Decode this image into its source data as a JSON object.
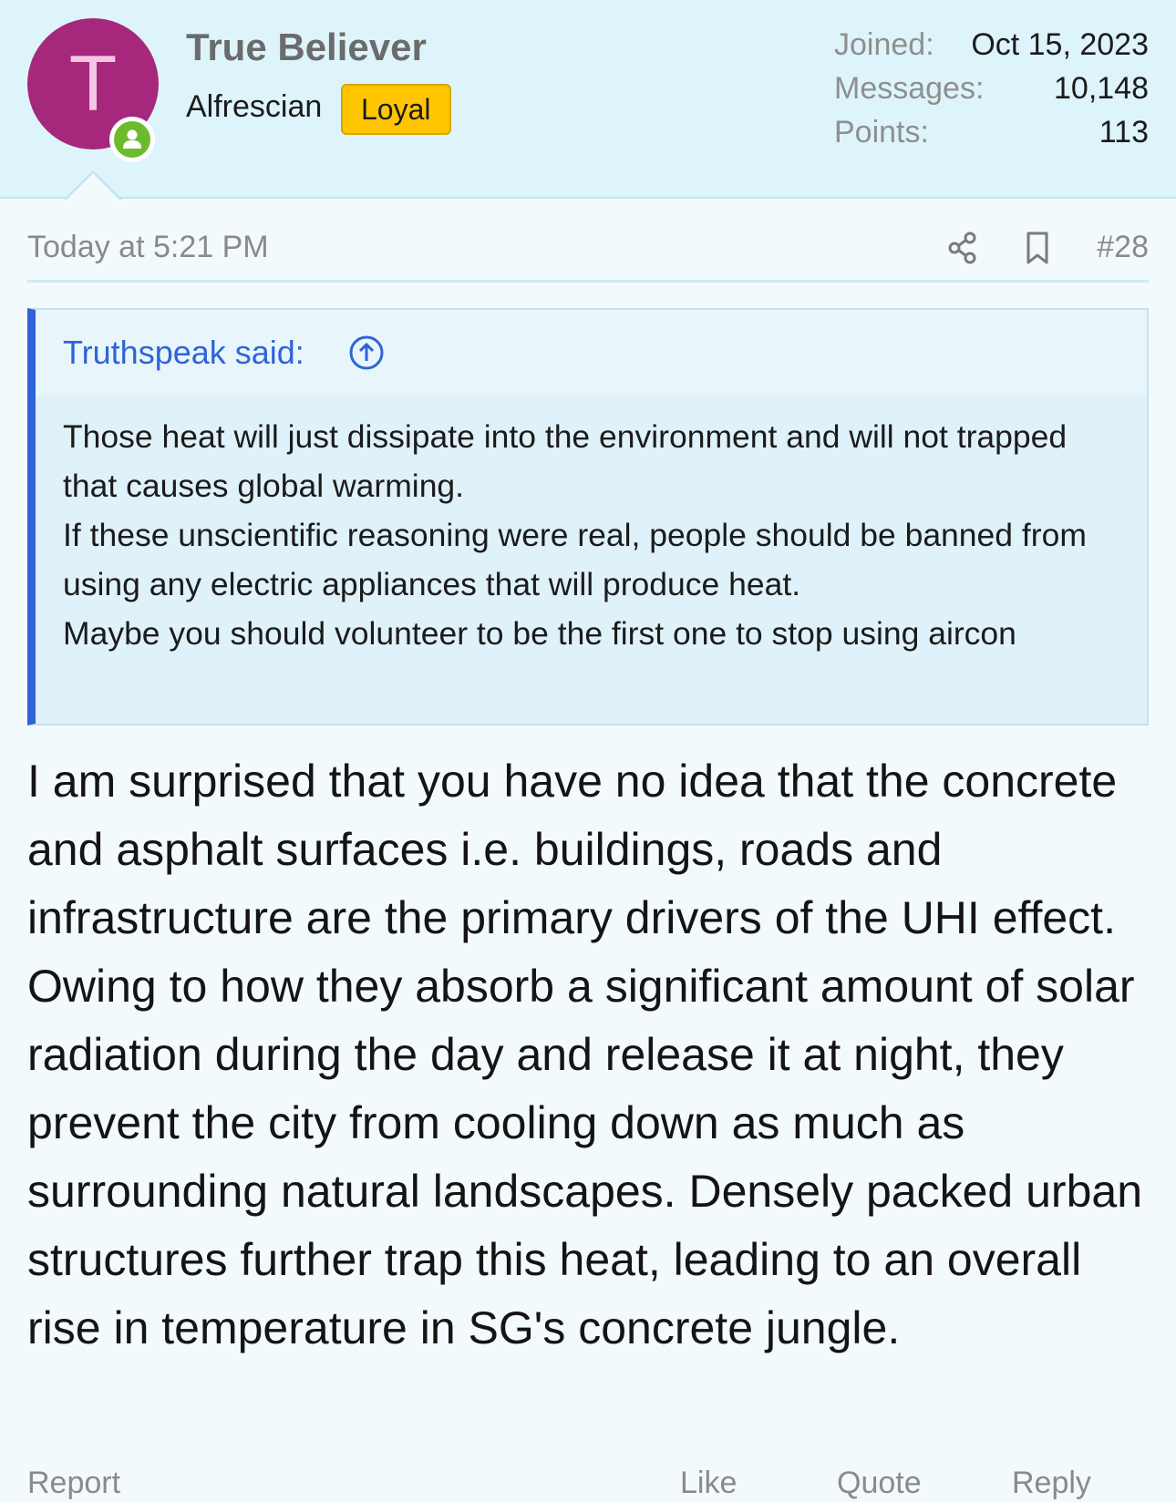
{
  "user": {
    "avatar_letter": "T",
    "avatar_color": "#a6287d",
    "online_status_color": "#6cbb2d",
    "name": "True Believer",
    "title": "Alfrescian",
    "badge": "Loyal",
    "badge_color": "#ffc600",
    "stats": [
      {
        "label": "Joined:",
        "value": "Oct 15, 2023"
      },
      {
        "label": "Messages:",
        "value": "10,148"
      },
      {
        "label": "Points:",
        "value": "113"
      }
    ]
  },
  "post": {
    "timestamp": "Today at 5:21 PM",
    "number": "#28",
    "share_icon": "share-icon",
    "bookmark_icon": "bookmark-icon",
    "quote": {
      "author": "Truthspeak said:",
      "jump_icon": "arrow-up-circle-icon",
      "lines": [
        "Those heat will just dissipate into the environment and will not trapped that causes global warming.",
        "If these unscientific reasoning were real, people should be banned from using any electric appliances that will produce heat.",
        "Maybe you should volunteer to be the first one to stop using aircon"
      ]
    },
    "body": "I am surprised that you have no idea that the concrete and asphalt surfaces i.e. buildings, roads and infrastructure are the primary drivers of the UHI effect. Owing to how they absorb a significant amount of solar radiation during the day and release it at night, they prevent the city from cooling down as much as surrounding natural landscapes. Densely packed urban structures further trap this heat, leading to an overall rise in temperature in SG's concrete jungle."
  },
  "actions": {
    "report": "Report",
    "like": "Like",
    "quote": "Quote",
    "reply": "Reply"
  },
  "colors": {
    "header_bg": "#def4fb",
    "page_bg": "#f3fafd",
    "quote_accent": "#2f64d8",
    "quote_bg": "#dff1f9"
  }
}
